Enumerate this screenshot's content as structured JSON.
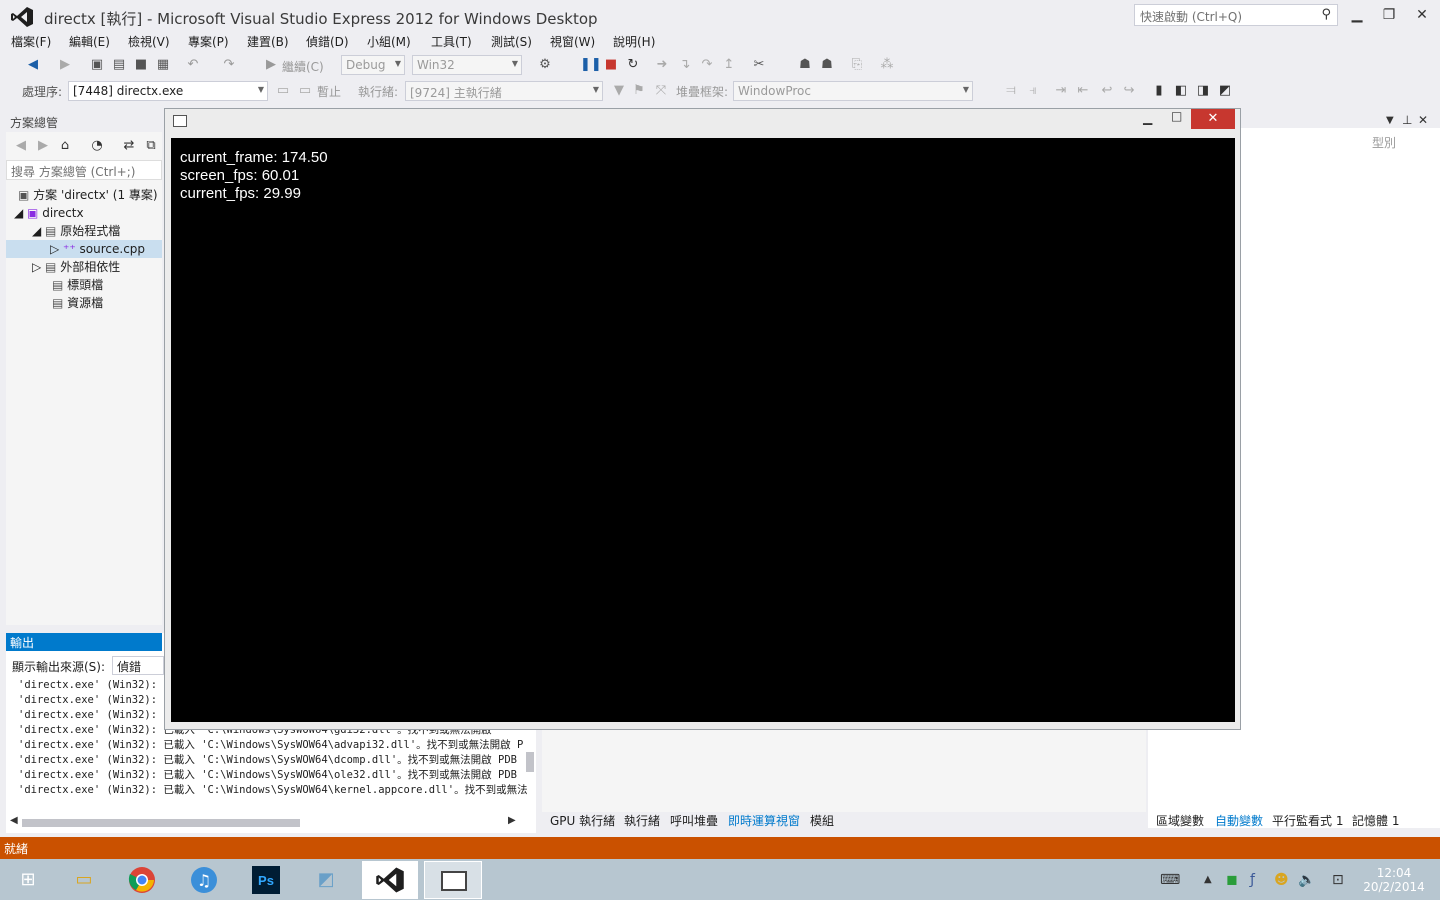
{
  "title": {
    "text": "directx [執行] - Microsoft Visual Studio Express 2012 for Windows Desktop"
  },
  "quick_launch": {
    "placeholder": "快速啟動 (Ctrl+Q)"
  },
  "menu": [
    "檔案(F)",
    "編輯(E)",
    "檢視(V)",
    "專案(P)",
    "建置(B)",
    "偵錯(D)",
    "小組(M)",
    "工具(T)",
    "測試(S)",
    "視窗(W)",
    "說明(H)"
  ],
  "toolbar": {
    "continue_label": "繼續(C)",
    "config": "Debug",
    "platform": "Win32",
    "process_label": "處理序:",
    "process_value": "[7448] directx.exe",
    "suspend_label": "暫止",
    "thread_label": "執行緒:",
    "thread_value": "[9724] 主執行緒",
    "stack_label": "堆疊框架:",
    "stack_value": "WindowProc"
  },
  "solution_explorer": {
    "title": "方案總管",
    "search_placeholder": "搜尋 方案總管 (Ctrl+;)",
    "solution": "方案 'directx' (1 專案)",
    "project": "directx",
    "source_folder": "原始程式檔",
    "source_file": "source.cpp",
    "external_deps": "外部相依性",
    "header_files": "標頭檔",
    "resource_files": "資源檔"
  },
  "right_panel": {
    "column_type": "型別"
  },
  "output": {
    "title": "輸出",
    "source_label": "顯示輸出來源(S):",
    "source_value": "偵錯",
    "lines": [
      "'directx.exe' (Win32): E",
      "'directx.exe' (Win32): E",
      "'directx.exe' (Win32): E",
      "'directx.exe' (Win32): 已載入 'C:\\Windows\\SysWOW64\\gdi32.dll'。找不到或無法開啟",
      "'directx.exe' (Win32): 已載入 'C:\\Windows\\SysWOW64\\advapi32.dll'。找不到或無法開啟 P",
      "'directx.exe' (Win32): 已載入 'C:\\Windows\\SysWOW64\\dcomp.dll'。找不到或無法開啟 PDB",
      "'directx.exe' (Win32): 已載入 'C:\\Windows\\SysWOW64\\ole32.dll'。找不到或無法開啟 PDB",
      "'directx.exe' (Win32): 已載入 'C:\\Windows\\SysWOW64\\kernel.appcore.dll'。找不到或無法"
    ]
  },
  "bottom_tabs_left": [
    "GPU 執行緒",
    "執行緒",
    "呼叫堆疊",
    "即時運算視窗",
    "模組"
  ],
  "bottom_tabs_right": [
    "區域變數",
    "自動變數",
    "平行監看式 1",
    "記憶體 1"
  ],
  "status": {
    "text": "就緒"
  },
  "game": {
    "current_frame": "current_frame: 174.50",
    "screen_fps": "screen_fps: 60.01",
    "current_fps": "current_fps: 29.99"
  },
  "clock": {
    "time": "12:04",
    "date": "20/2/2014"
  },
  "colors": {
    "accent": "#007acc",
    "status": "#ca5100",
    "close": "#c7372f"
  }
}
